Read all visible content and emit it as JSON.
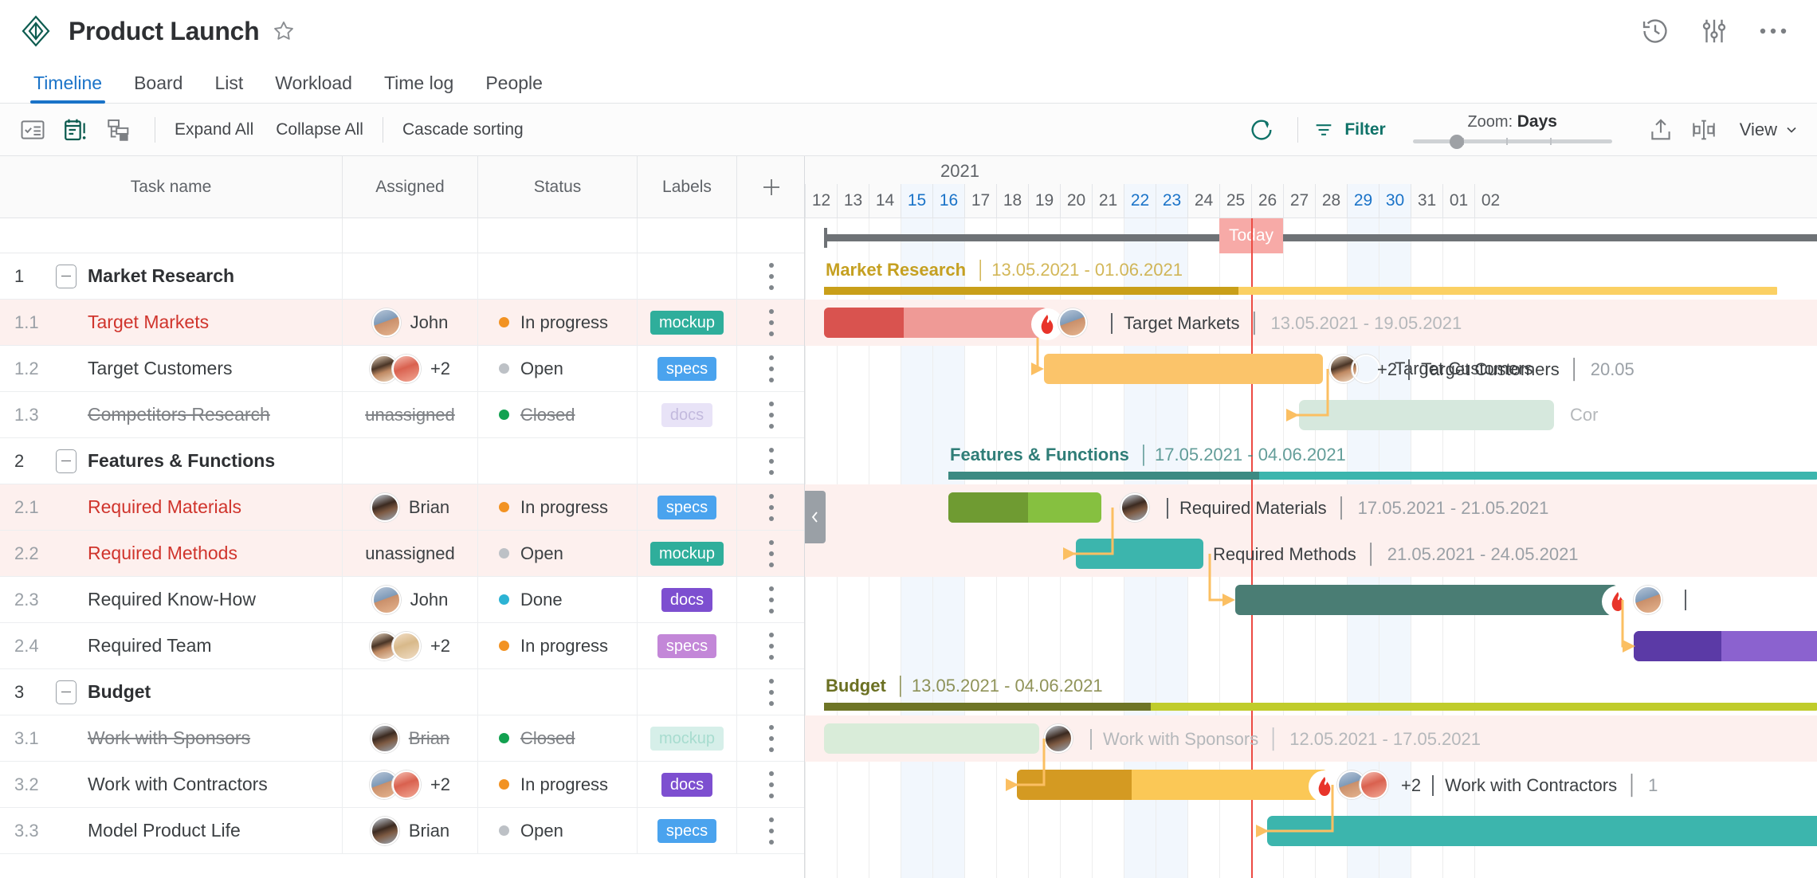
{
  "header": {
    "project_title": "Product Launch",
    "logo_icon": "diamond-logo-icon",
    "star_icon": "star-icon",
    "history_icon": "history-clock-icon",
    "settings_icon": "sliders-icon",
    "more_icon": "more-horizontal-icon"
  },
  "tabs": [
    {
      "label": "Timeline",
      "active": true
    },
    {
      "label": "Board",
      "active": false
    },
    {
      "label": "List",
      "active": false
    },
    {
      "label": "Workload",
      "active": false
    },
    {
      "label": "Time log",
      "active": false
    },
    {
      "label": "People",
      "active": false
    }
  ],
  "toolbar": {
    "icons": [
      "checklist-icon",
      "calendar-alert-icon",
      "hierarchy-icon"
    ],
    "expand_all": "Expand All",
    "collapse_all": "Collapse All",
    "cascade_sorting": "Cascade sorting",
    "refresh_icon": "refresh-icon",
    "filter_icon": "filter-icon",
    "filter_label": "Filter",
    "zoom_prefix": "Zoom:",
    "zoom_value": "Days",
    "export_icon": "upload-export-icon",
    "fit_icon": "fit-to-screen-icon",
    "view_label": "View",
    "view_caret": "chevron-down-icon"
  },
  "grid": {
    "columns": [
      "Task name",
      "Assigned",
      "Status",
      "Labels"
    ],
    "add_column_icon": "plus-icon",
    "row_menu_icon": "kebab-menu-icon",
    "rows": [
      {
        "wbs": "1",
        "name": "Market Research",
        "type": "group",
        "assigned": "",
        "plus": "",
        "status": "",
        "label": "",
        "style": "normal"
      },
      {
        "wbs": "1.1",
        "name": "Target Markets",
        "type": "task",
        "assigned": "John",
        "plus": "",
        "status": "In progress",
        "label": "mockup",
        "style": "red"
      },
      {
        "wbs": "1.2",
        "name": "Target Customers",
        "type": "task",
        "assigned": "",
        "plus": "+2",
        "status": "Open",
        "label": "specs",
        "style": "normal"
      },
      {
        "wbs": "1.3",
        "name": "Competitors Research",
        "type": "task",
        "assigned": "unassigned",
        "plus": "",
        "status": "Closed",
        "label": "docs",
        "style": "struck"
      },
      {
        "wbs": "2",
        "name": "Features & Functions",
        "type": "group",
        "assigned": "",
        "plus": "",
        "status": "",
        "label": "",
        "style": "normal"
      },
      {
        "wbs": "2.1",
        "name": "Required Materials",
        "type": "task",
        "assigned": "Brian",
        "plus": "",
        "status": "In progress",
        "label": "specs",
        "style": "red"
      },
      {
        "wbs": "2.2",
        "name": "Required Methods",
        "type": "task",
        "assigned": "unassigned",
        "plus": "",
        "status": "Open",
        "label": "mockup",
        "style": "red"
      },
      {
        "wbs": "2.3",
        "name": "Required Know-How",
        "type": "task",
        "assigned": "John",
        "plus": "",
        "status": "Done",
        "label": "docs",
        "style": "normal"
      },
      {
        "wbs": "2.4",
        "name": "Required Team",
        "type": "task",
        "assigned": "",
        "plus": "+2",
        "status": "In progress",
        "label": "specs",
        "style": "normal"
      },
      {
        "wbs": "3",
        "name": "Budget",
        "type": "group",
        "assigned": "",
        "plus": "",
        "status": "",
        "label": "",
        "style": "normal"
      },
      {
        "wbs": "3.1",
        "name": "Work with Sponsors",
        "type": "task",
        "assigned": "Brian",
        "plus": "",
        "status": "Closed",
        "label": "mockup",
        "style": "struck"
      },
      {
        "wbs": "3.2",
        "name": "Work with Contractors",
        "type": "task",
        "assigned": "",
        "plus": "+2",
        "status": "In progress",
        "label": "docs",
        "style": "normal"
      },
      {
        "wbs": "3.3",
        "name": "Model Product Life",
        "type": "task",
        "assigned": "Brian",
        "plus": "",
        "status": "Open",
        "label": "specs",
        "style": "normal"
      }
    ]
  },
  "timeline": {
    "year": "2021",
    "days": [
      "12",
      "13",
      "14",
      "15",
      "16",
      "17",
      "18",
      "19",
      "20",
      "21",
      "22",
      "23",
      "24",
      "25",
      "26",
      "27",
      "28",
      "29",
      "30",
      "31",
      "01",
      "02"
    ],
    "weekend_days": [
      "15",
      "16",
      "22",
      "23",
      "29",
      "30"
    ],
    "today_label": "Today",
    "today_day": "25",
    "bars": [
      {
        "wbs": "1",
        "name": "Market Research",
        "dates": "13.05.2021 - 01.06.2021",
        "kind": "summary",
        "label_color": "#c5a021"
      },
      {
        "wbs": "1.1",
        "name": "Target Markets",
        "dates": "13.05.2021 - 19.05.2021",
        "kind": "task",
        "color": "#ef9a96",
        "progress_color": "#d9534f",
        "flame": true
      },
      {
        "wbs": "1.2",
        "name": "Target Customers",
        "dates": "20.05",
        "kind": "task",
        "color": "#fbc46a",
        "flame": false
      },
      {
        "wbs": "1.3",
        "name": "Competitors Research",
        "dates": "",
        "kind": "task",
        "color": "#d6e8dd",
        "flame": false
      },
      {
        "wbs": "2",
        "name": "Features & Functions",
        "dates": "17.05.2021 - 04.06.2021",
        "kind": "summary",
        "label_color": "#2f7d77"
      },
      {
        "wbs": "2.1",
        "name": "Required Materials",
        "dates": "17.05.2021 - 21.05.2021",
        "kind": "task",
        "color": "#86c040",
        "progress_color": "#6f9b32",
        "flame": false
      },
      {
        "wbs": "2.2",
        "name": "Required Methods",
        "dates": "21.05.2021 - 24.05.2021",
        "kind": "task",
        "color": "#3cb5ad",
        "flame": false
      },
      {
        "wbs": "2.3",
        "name": "Required Know-How",
        "dates": "",
        "kind": "task",
        "color": "#4a7d74",
        "flame": true
      },
      {
        "wbs": "2.4",
        "name": "Required Team",
        "dates": "",
        "kind": "task",
        "color": "#8b62cf",
        "progress_color": "#5b3aa6",
        "flame": false
      },
      {
        "wbs": "3",
        "name": "Budget",
        "dates": "13.05.2021 - 04.06.2021",
        "kind": "summary",
        "label_color": "#6b7022"
      },
      {
        "wbs": "3.1",
        "name": "Work with Sponsors",
        "dates": "12.05.2021 - 17.05.2021",
        "kind": "task",
        "color": "#d9ecd9",
        "flame": false
      },
      {
        "wbs": "3.2",
        "name": "Work with Contractors",
        "dates": "1",
        "kind": "task",
        "color": "#fbc856",
        "progress_color": "#d49a22",
        "flame": true
      },
      {
        "wbs": "3.3",
        "name": "Model Product Life",
        "dates": "",
        "kind": "task",
        "color": "#3cb5ad",
        "flame": false
      }
    ]
  },
  "colors": {
    "accent_blue": "#1a73c8",
    "teal": "#0f7268",
    "today_red": "#ec4b43",
    "today_chip": "#f7aaa7",
    "status_in_progress": "#f29222",
    "status_open": "#bdc1c6",
    "status_closed": "#12a150",
    "status_done": "#2cb3d4",
    "label_mockup": "#2fae9b",
    "label_specs": "#4aa3ee",
    "label_docs": "#7d4fd0",
    "row_highlight": "#fdf0ee",
    "link_arrow": "#fbbf62"
  },
  "pane_handle_icon": "collapse-pane-icon"
}
